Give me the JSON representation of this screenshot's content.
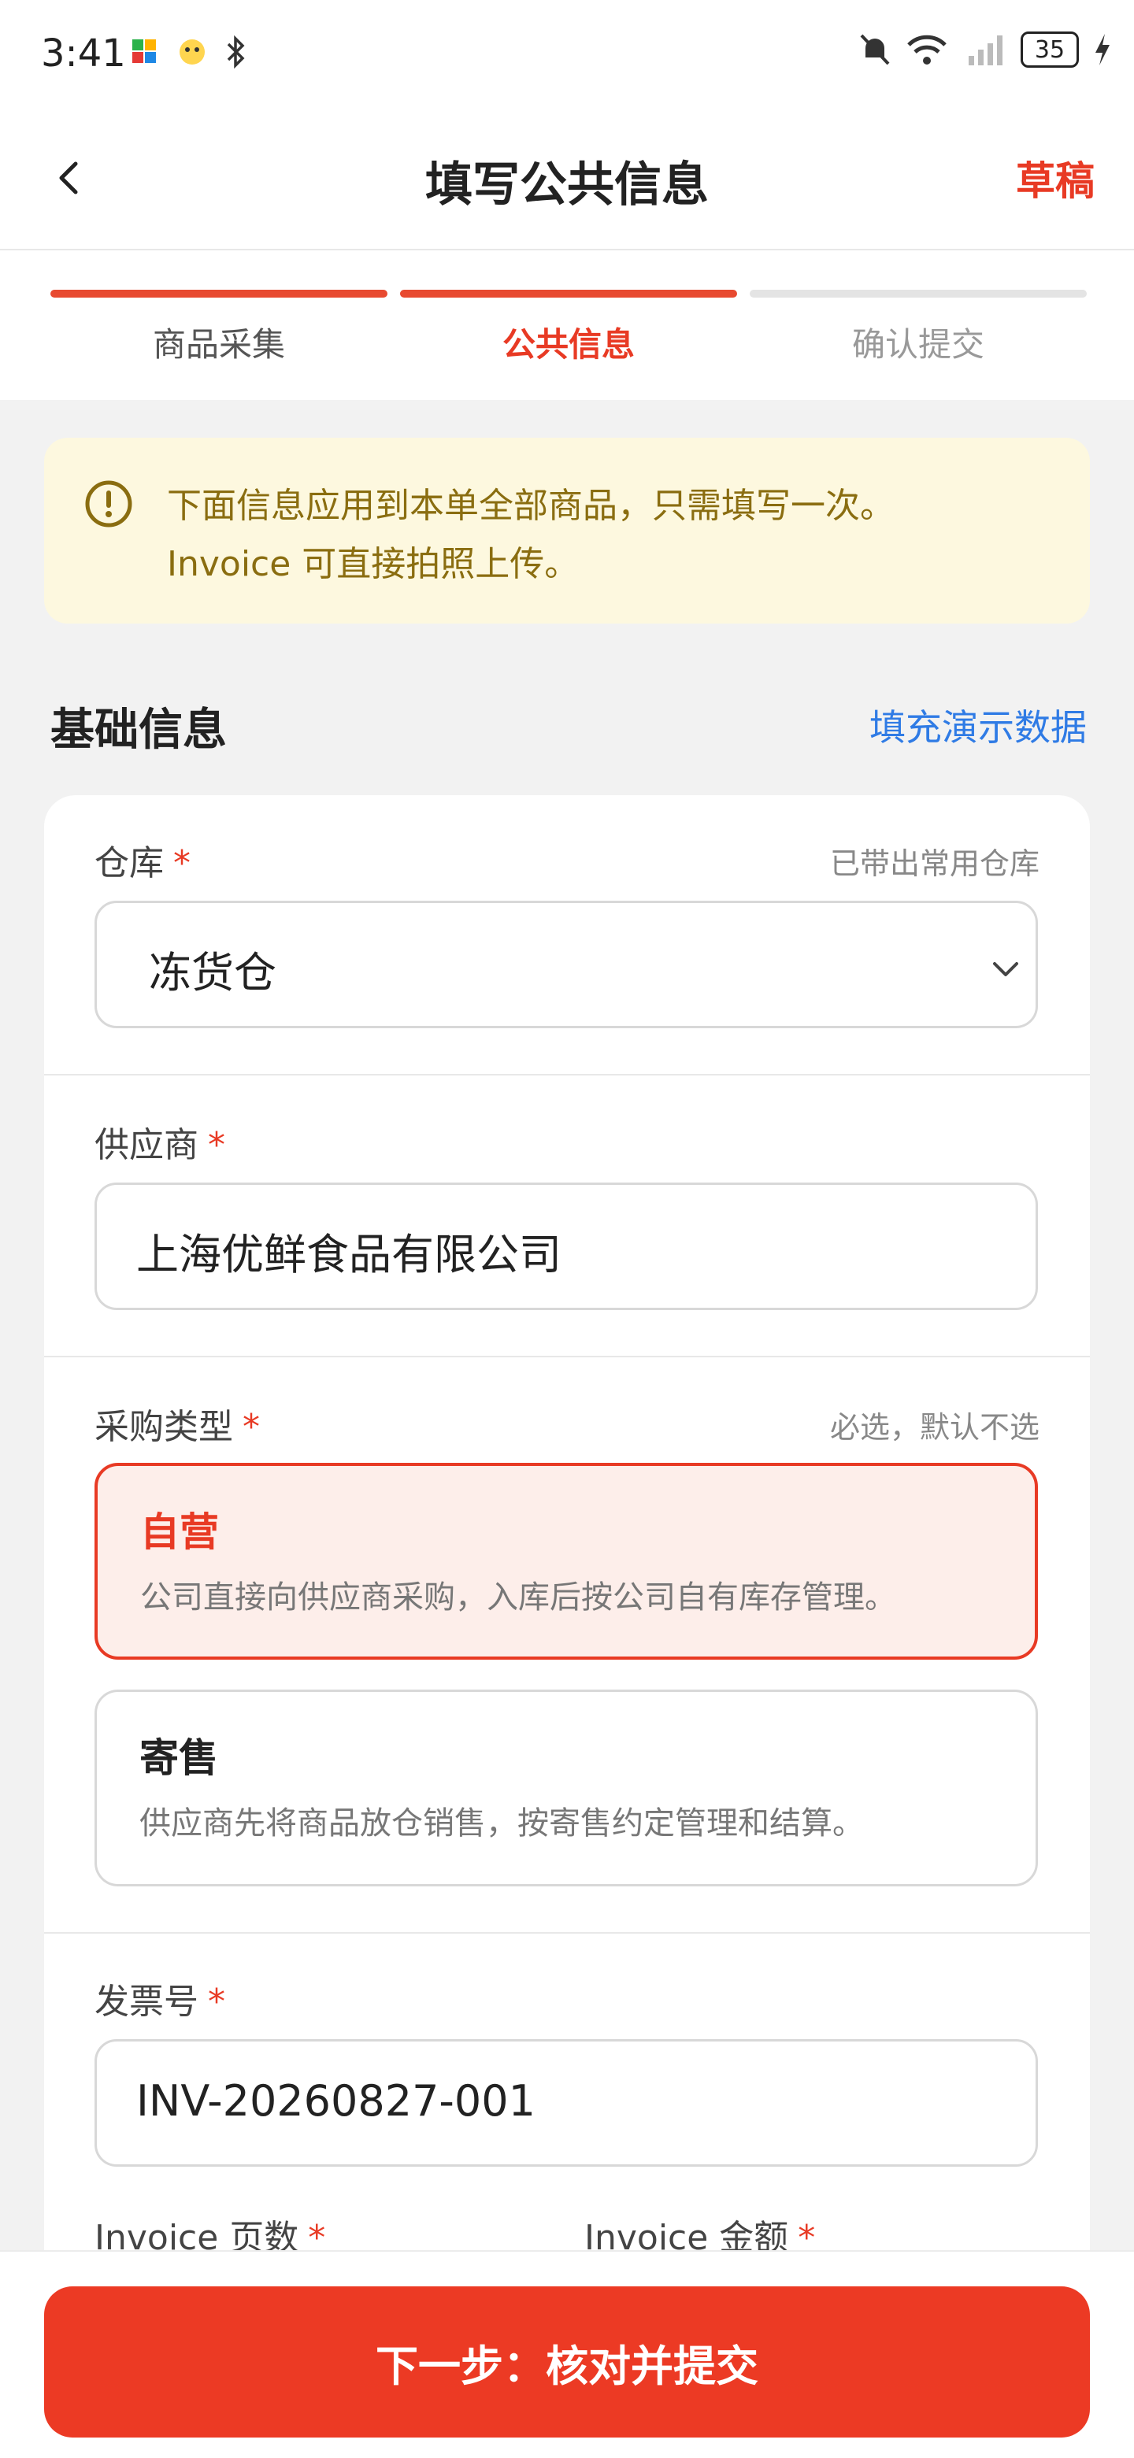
{
  "status_bar": {
    "time": "3:41",
    "battery": "35",
    "icons": [
      "app-icon",
      "emoji-app-icon",
      "bluetooth-icon",
      "mute-bell-icon",
      "wifi-icon",
      "cell-signal-icon",
      "charging-icon"
    ]
  },
  "app_bar": {
    "title": "填写公共信息",
    "draft_label": "草稿"
  },
  "stepper": {
    "steps": [
      {
        "label": "商品采集"
      },
      {
        "label": "公共信息"
      },
      {
        "label": "确认提交"
      }
    ]
  },
  "notice": {
    "line1": "下面信息应用到本单全部商品，只需填写一次。",
    "line2": "Invoice 可直接拍照上传。"
  },
  "section": {
    "title": "基础信息",
    "fill_demo_label": "填充演示数据"
  },
  "form": {
    "warehouse": {
      "label": "仓库",
      "required_mark": "*",
      "hint": "已带出常用仓库",
      "value": "冻货仓"
    },
    "supplier": {
      "label": "供应商",
      "required_mark": "*",
      "value": "上海优鲜食品有限公司"
    },
    "purchase_type": {
      "label": "采购类型",
      "required_mark": "*",
      "hint": "必选，默认不选",
      "options": [
        {
          "title": "自营",
          "desc": "公司直接向供应商采购，入库后按公司自有库存管理。"
        },
        {
          "title": "寄售",
          "desc": "供应商先将商品放仓销售，按寄售约定管理和结算。"
        }
      ]
    },
    "invoice_no": {
      "label": "发票号",
      "required_mark": "*",
      "value": "INV-20260827-001"
    },
    "invoice_pages": {
      "label": "Invoice 页数",
      "required_mark": "*"
    },
    "invoice_amount": {
      "label": "Invoice 金额",
      "required_mark": "*"
    }
  },
  "bottom": {
    "primary_label": "下一步：核对并提交"
  },
  "colors": {
    "accent": "#e83a24",
    "link": "#2f7be5",
    "notice_bg": "#fdf8df",
    "notice_text": "#8a6d10"
  }
}
